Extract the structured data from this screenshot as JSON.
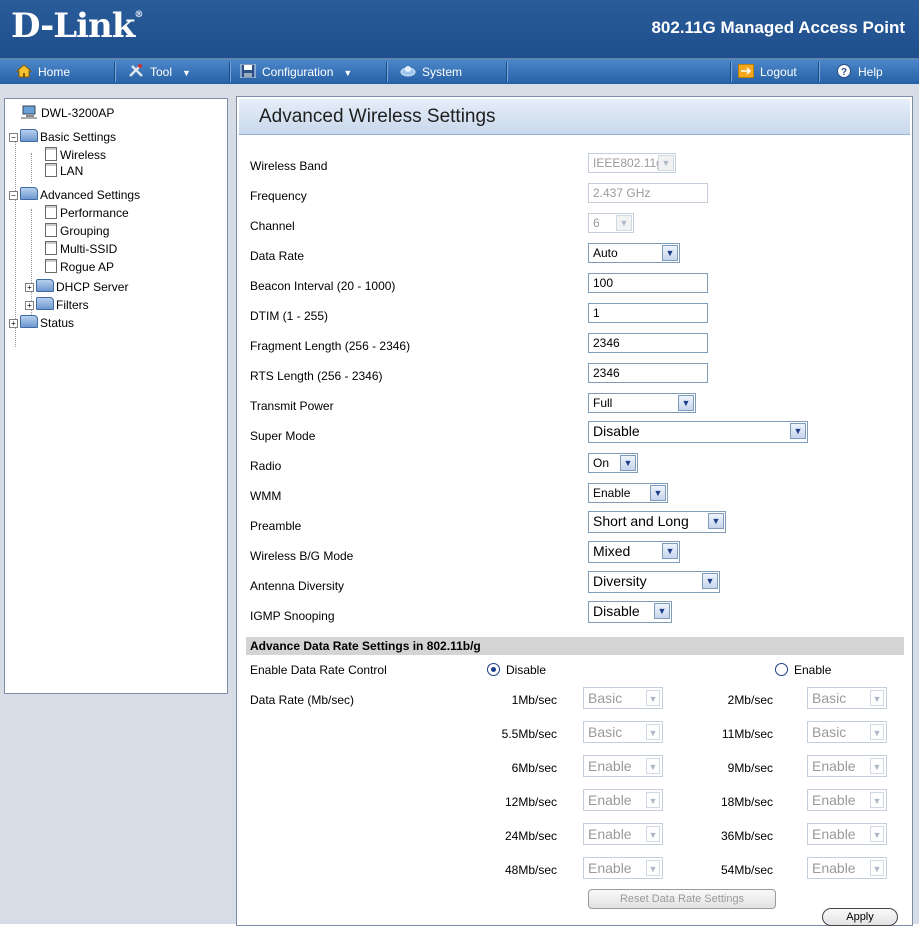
{
  "header": {
    "logo": "D-Link",
    "product": "802.11G Managed Access Point"
  },
  "menu": {
    "home": "Home",
    "tool": "Tool",
    "configuration": "Configuration",
    "system": "System",
    "logout": "Logout",
    "help": "Help"
  },
  "tree": {
    "device": "DWL-3200AP",
    "basic": "Basic Settings",
    "wireless": "Wireless",
    "lan": "LAN",
    "advanced": "Advanced Settings",
    "performance": "Performance",
    "grouping": "Grouping",
    "multissid": "Multi-SSID",
    "rogue": "Rogue AP",
    "dhcp": "DHCP Server",
    "filters": "Filters",
    "status": "Status"
  },
  "title": "Advanced Wireless Settings",
  "fields": {
    "band": {
      "label": "Wireless Band",
      "value": "IEEE802.11g"
    },
    "freq": {
      "label": "Frequency",
      "value": "2.437 GHz"
    },
    "channel": {
      "label": "Channel",
      "value": "6"
    },
    "rate": {
      "label": "Data Rate",
      "value": "Auto"
    },
    "beacon": {
      "label": "Beacon Interval (20 - 1000)",
      "value": "100"
    },
    "dtim": {
      "label": "DTIM (1 - 255)",
      "value": "1"
    },
    "frag": {
      "label": "Fragment Length (256 - 2346)",
      "value": "2346"
    },
    "rts": {
      "label": "RTS Length (256 - 2346)",
      "value": "2346"
    },
    "power": {
      "label": "Transmit Power",
      "value": "Full"
    },
    "super": {
      "label": "Super Mode",
      "value": "Disable"
    },
    "radio": {
      "label": "Radio",
      "value": "On"
    },
    "wmm": {
      "label": "WMM",
      "value": "Enable"
    },
    "preamble": {
      "label": "Preamble",
      "value": "Short and Long"
    },
    "bgmode": {
      "label": "Wireless B/G Mode",
      "value": "Mixed"
    },
    "antenna": {
      "label": "Antenna Diversity",
      "value": "Diversity"
    },
    "igmp": {
      "label": "IGMP Snooping",
      "value": "Disable"
    }
  },
  "advanced": {
    "section": "Advance Data Rate Settings in 802.11b/g",
    "control_label": "Enable Data Rate Control",
    "disable": "Disable",
    "enable": "Enable",
    "rate_label": "Data Rate (Mb/sec)",
    "rates": [
      {
        "label": "1Mb/sec",
        "value": "Basic"
      },
      {
        "label": "2Mb/sec",
        "value": "Basic"
      },
      {
        "label": "5.5Mb/sec",
        "value": "Basic"
      },
      {
        "label": "11Mb/sec",
        "value": "Basic"
      },
      {
        "label": "6Mb/sec",
        "value": "Enable"
      },
      {
        "label": "9Mb/sec",
        "value": "Enable"
      },
      {
        "label": "12Mb/sec",
        "value": "Enable"
      },
      {
        "label": "18Mb/sec",
        "value": "Enable"
      },
      {
        "label": "24Mb/sec",
        "value": "Enable"
      },
      {
        "label": "36Mb/sec",
        "value": "Enable"
      },
      {
        "label": "48Mb/sec",
        "value": "Enable"
      },
      {
        "label": "54Mb/sec",
        "value": "Enable"
      }
    ],
    "reset": "Reset Data Rate Settings",
    "apply": "Apply"
  }
}
